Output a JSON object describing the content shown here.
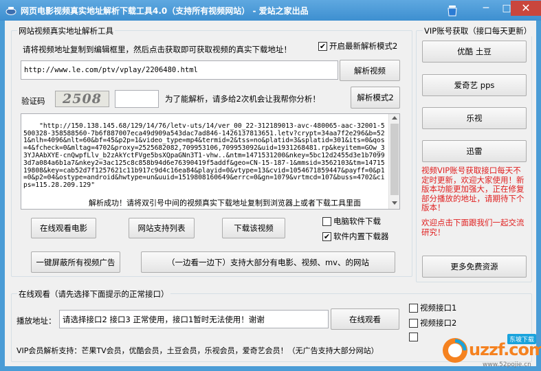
{
  "window": {
    "title": "网页电影视频真实地址解析下载工具4.0（支持所有视频网站） - 爱站之家出品",
    "min_label": "─",
    "max_label": "□",
    "close_label": "✕",
    "app_icon": "app-icon",
    "skin_icon": "skin-icon"
  },
  "parse_group": {
    "legend": "网站视频真实地址解析工具",
    "instruction": "请将视频地址复制到编辑框里，然后点击获取即可获取视频的真实下载地址！",
    "latest_mode_label": "开启最新解析模式2",
    "latest_mode_checked": true,
    "url_value": "http://www.le.com/ptv/vplay/2206480.html",
    "parse_button": "解析视频",
    "captcha_label": "验证码",
    "captcha_text": "2508",
    "captcha_input": "",
    "captcha_hint": "为了能解析，请多给2次机会让我帮你分析！",
    "parse_mode2_button": "解析模式2",
    "result_text": "\"http://150.138.145.68/129/14/76/letv-uts/14/ver_00_22-312189013-avc-480065-aac-32001-5500328-358588560-7b6f887007eca49d909a543dac7ad846-1426137813651.letv?crypt=34aa7f2e296&b=521&nlh=4096&nlt=60&bf=45&p2p=1&video_type=mp4&termid=2&tss=no&platid=3&splatid=301&its=0&qos=4&fcheck=0&mltag=4702&proxy=2525682082,709953106,709953092&uid=1931268481.rp&keyitem=GOw_33YJAAbXYE-cnQwpfLlv_b2zAkYctFVge5bsXQpaGNn3T1-vhw..&ntm=1471531200&nkey=5bc12d2455d3e1b70993d7a084a6b1a7&nkey2=3ac125c8c858b94d6e76390419f5addf&geo=CN-15-187-1&mmsid=3562103&tm=1471519808&key=cab52d7f1257621c11b917c9d4c16ea84&playid=0&vtype=13&cvid=1054671859447&payff=0&p1=0&p2=04&ostype=android&hwtype=un&uuid=1519808160649&errc=0&gn=1079&vrtmcd=107&buss=4702&cips=115.28.209.129\"",
    "result_status": "解析成功！请将双引号中间的视频真实下载地址复制到浏览器上或者下载工具里面"
  },
  "actions": {
    "watch_online": "在线观看电影",
    "supported_sites": "网站支持列表",
    "download_video": "下载该视频",
    "pc_download_label": "电脑软件下载",
    "pc_download_checked": false,
    "builtin_download_label": "软件内置下载器",
    "builtin_download_checked": true,
    "block_ads": "一键屏蔽所有视频广告",
    "watch_download": "（一边看一边下）支持大部分有电影、视频、mv、的网站"
  },
  "vip_group": {
    "legend": "VIP账号获取（接口每天更新）",
    "buttons": [
      "优酷 土豆",
      "爱奇艺 pps",
      "乐视",
      "迅雷"
    ],
    "notice": "视频VIP账号获取接口每天不定时更新，欢迎大家使用！新版本功能更加强大，正在修复部分播放的地址，请期待下个版本！",
    "welcome": "欢迎点击下面跟我们一起交流研究！",
    "more_button": "更多免费资源"
  },
  "online_group": {
    "legend": "在线观看（请先选择下面提示的正常接口）",
    "play_label": "播放地址：",
    "play_value": "请选择接口2 接口3 正常使用，接口1暂时无法使用！谢谢",
    "watch_button": "在线观看",
    "interface1": "视频接口1",
    "interface2": "视频接口2",
    "interface1_checked": false,
    "interface2_checked": false,
    "interface3_checked": false,
    "vip_support": "VIP会员解析支持：芒果TV会员，优酷会员，土豆会员，乐视会员，爱奇艺会员！（无广告支持大部分网站）"
  },
  "watermark": {
    "brand": "uzzf.com",
    "badge": "东坡下载",
    "url": "www.52pojie.cn"
  },
  "colors": {
    "title_bar": "#4a9cd6",
    "close_button": "#c9463d",
    "notice_red": "#e02020",
    "watermark_orange": "#f58220"
  }
}
